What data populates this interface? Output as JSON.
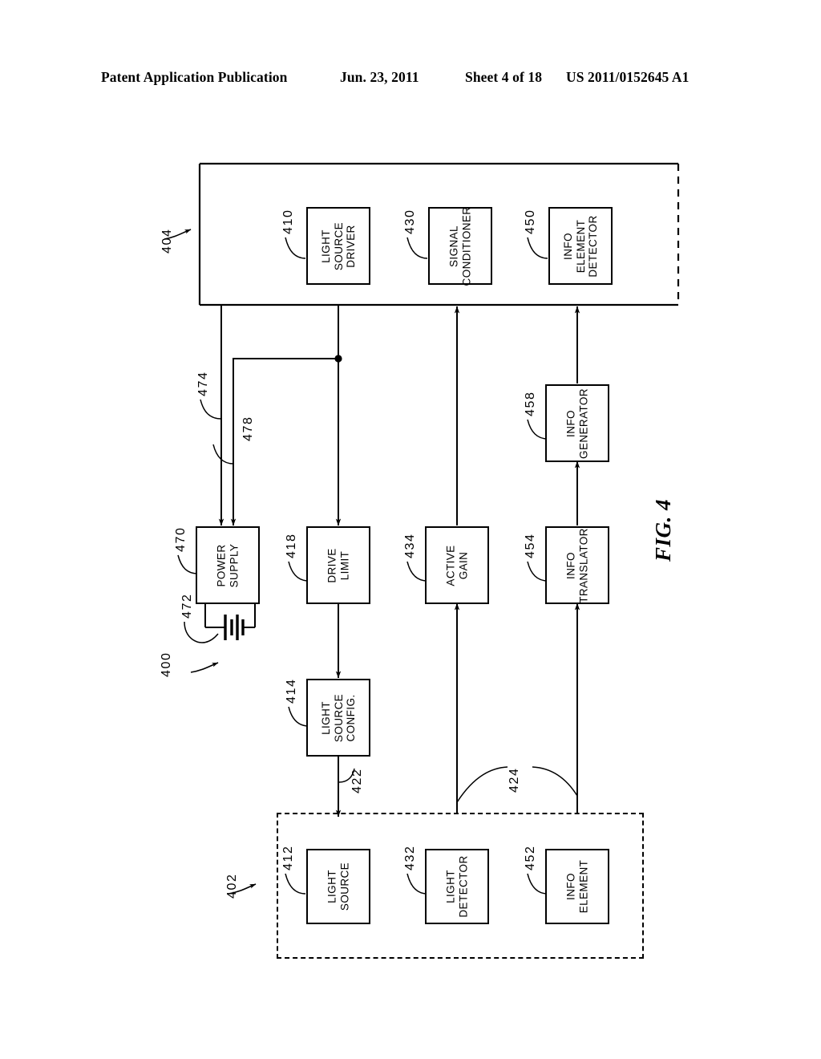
{
  "header": {
    "publication": "Patent Application Publication",
    "date": "Jun. 23, 2011",
    "sheet": "Sheet 4 of 18",
    "patent_number": "US 2011/0152645 A1"
  },
  "figure": {
    "caption": "FIG. 4",
    "system_ref": "400"
  },
  "enclosures": [
    {
      "id": "404",
      "ref": "404",
      "style": "solid-open-right"
    },
    {
      "id": "402",
      "ref": "402",
      "style": "dashed"
    }
  ],
  "blocks": [
    {
      "id": "410",
      "ref": "410",
      "label": "LIGHT\nSOURCE\nDRIVER"
    },
    {
      "id": "430",
      "ref": "430",
      "label": "SIGNAL\nCONDITIONER"
    },
    {
      "id": "450",
      "ref": "450",
      "label": "INFO\nELEMENT\nDETECTOR"
    },
    {
      "id": "470",
      "ref": "470",
      "label": "POWER\nSUPPLY"
    },
    {
      "id": "418",
      "ref": "418",
      "label": "DRIVE\nLIMIT"
    },
    {
      "id": "434",
      "ref": "434",
      "label": "ACTIVE\nGAIN"
    },
    {
      "id": "454",
      "ref": "454",
      "label": "INFO\nTRANSLATOR"
    },
    {
      "id": "458",
      "ref": "458",
      "label": "INFO\nGENERATOR"
    },
    {
      "id": "414",
      "ref": "414",
      "label": "LIGHT\nSOURCE\nCONFIG."
    },
    {
      "id": "412",
      "ref": "412",
      "label": "LIGHT\nSOURCE"
    },
    {
      "id": "432",
      "ref": "432",
      "label": "LIGHT\nDETECTOR"
    },
    {
      "id": "452",
      "ref": "452",
      "label": "INFO\nELEMENT"
    }
  ],
  "block_labels": {
    "b410": "LIGHT SOURCE DRIVER",
    "b430": "SIGNAL CONDITIONER",
    "b450": "INFO ELEMENT DETECTOR",
    "b470": "POWER SUPPLY",
    "b418": "DRIVE LIMIT",
    "b434": "ACTIVE GAIN",
    "b454": "INFO TRANSLATOR",
    "b458": "INFO GENERATOR",
    "b414": "LIGHT SOURCE CONFIG.",
    "b412": "LIGHT SOURCE",
    "b432": "LIGHT DETECTOR",
    "b452": "INFO ELEMENT"
  },
  "block_lines": {
    "b410": [
      "LIGHT",
      "SOURCE",
      "DRIVER"
    ],
    "b430": [
      "SIGNAL",
      "CONDITIONER"
    ],
    "b450": [
      "INFO",
      "ELEMENT",
      "DETECTOR"
    ],
    "b470": [
      "POWER",
      "SUPPLY"
    ],
    "b418": [
      "DRIVE",
      "LIMIT"
    ],
    "b434": [
      "ACTIVE",
      "GAIN"
    ],
    "b454": [
      "INFO",
      "TRANSLATOR"
    ],
    "b458": [
      "INFO",
      "GENERATOR"
    ],
    "b414": [
      "LIGHT",
      "SOURCE",
      "CONFIG."
    ],
    "b412": [
      "LIGHT",
      "SOURCE"
    ],
    "b432": [
      "LIGHT",
      "DETECTOR"
    ],
    "b452": [
      "INFO",
      "ELEMENT"
    ]
  },
  "refs": {
    "r400": "400",
    "r402": "402",
    "r404": "404",
    "r410": "410",
    "r412": "412",
    "r414": "414",
    "r418": "418",
    "r422": "422",
    "r424": "424",
    "r430": "430",
    "r432": "432",
    "r434": "434",
    "r450": "450",
    "r452": "452",
    "r454": "454",
    "r458": "458",
    "r470": "470",
    "r472": "472",
    "r474": "474",
    "r478": "478"
  },
  "symbols": [
    {
      "id": "472",
      "ref": "472",
      "type": "battery-symbol"
    }
  ],
  "colors": {
    "ink": "#000000",
    "paper": "#ffffff"
  }
}
